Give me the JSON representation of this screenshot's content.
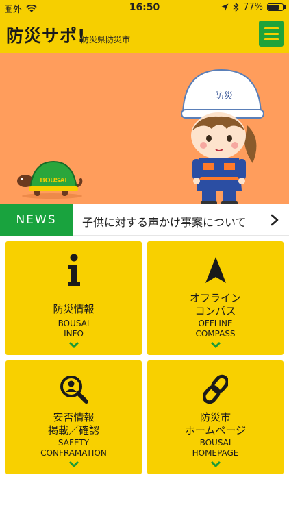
{
  "status_bar": {
    "carrier": "圏外",
    "time": "16:50",
    "battery": "77%",
    "battery_level": 0.77
  },
  "header": {
    "logo": "防災サポ!",
    "subtitle": "防災県防災市",
    "menu_icon": "hamburger-menu-icon"
  },
  "hero": {
    "turtle_label": "BOUSAI",
    "helmet_text": "防災"
  },
  "news": {
    "label": "NEWS",
    "headline": "子供に対する声かけ事案について"
  },
  "tiles": [
    {
      "icon": "info-icon",
      "title_lines": [
        "防災情報"
      ],
      "en_lines": [
        "BOUSAI",
        "INFO"
      ]
    },
    {
      "icon": "compass-arrow-icon",
      "title_lines": [
        "オフライン",
        "コンパス"
      ],
      "en_lines": [
        "OFFLINE",
        "COMPASS"
      ]
    },
    {
      "icon": "person-search-icon",
      "title_lines": [
        "安否情報",
        "掲載／確認"
      ],
      "en_lines": [
        "SAFETY",
        "CONFRAMATION"
      ]
    },
    {
      "icon": "link-icon",
      "title_lines": [
        "防災市",
        "ホームページ"
      ],
      "en_lines": [
        "BOUSAI",
        "HOMEPAGE"
      ]
    }
  ],
  "colors": {
    "brand_yellow": "#f6cf00",
    "brand_green": "#19a33e",
    "hero_orange": "#ff9d5c"
  }
}
